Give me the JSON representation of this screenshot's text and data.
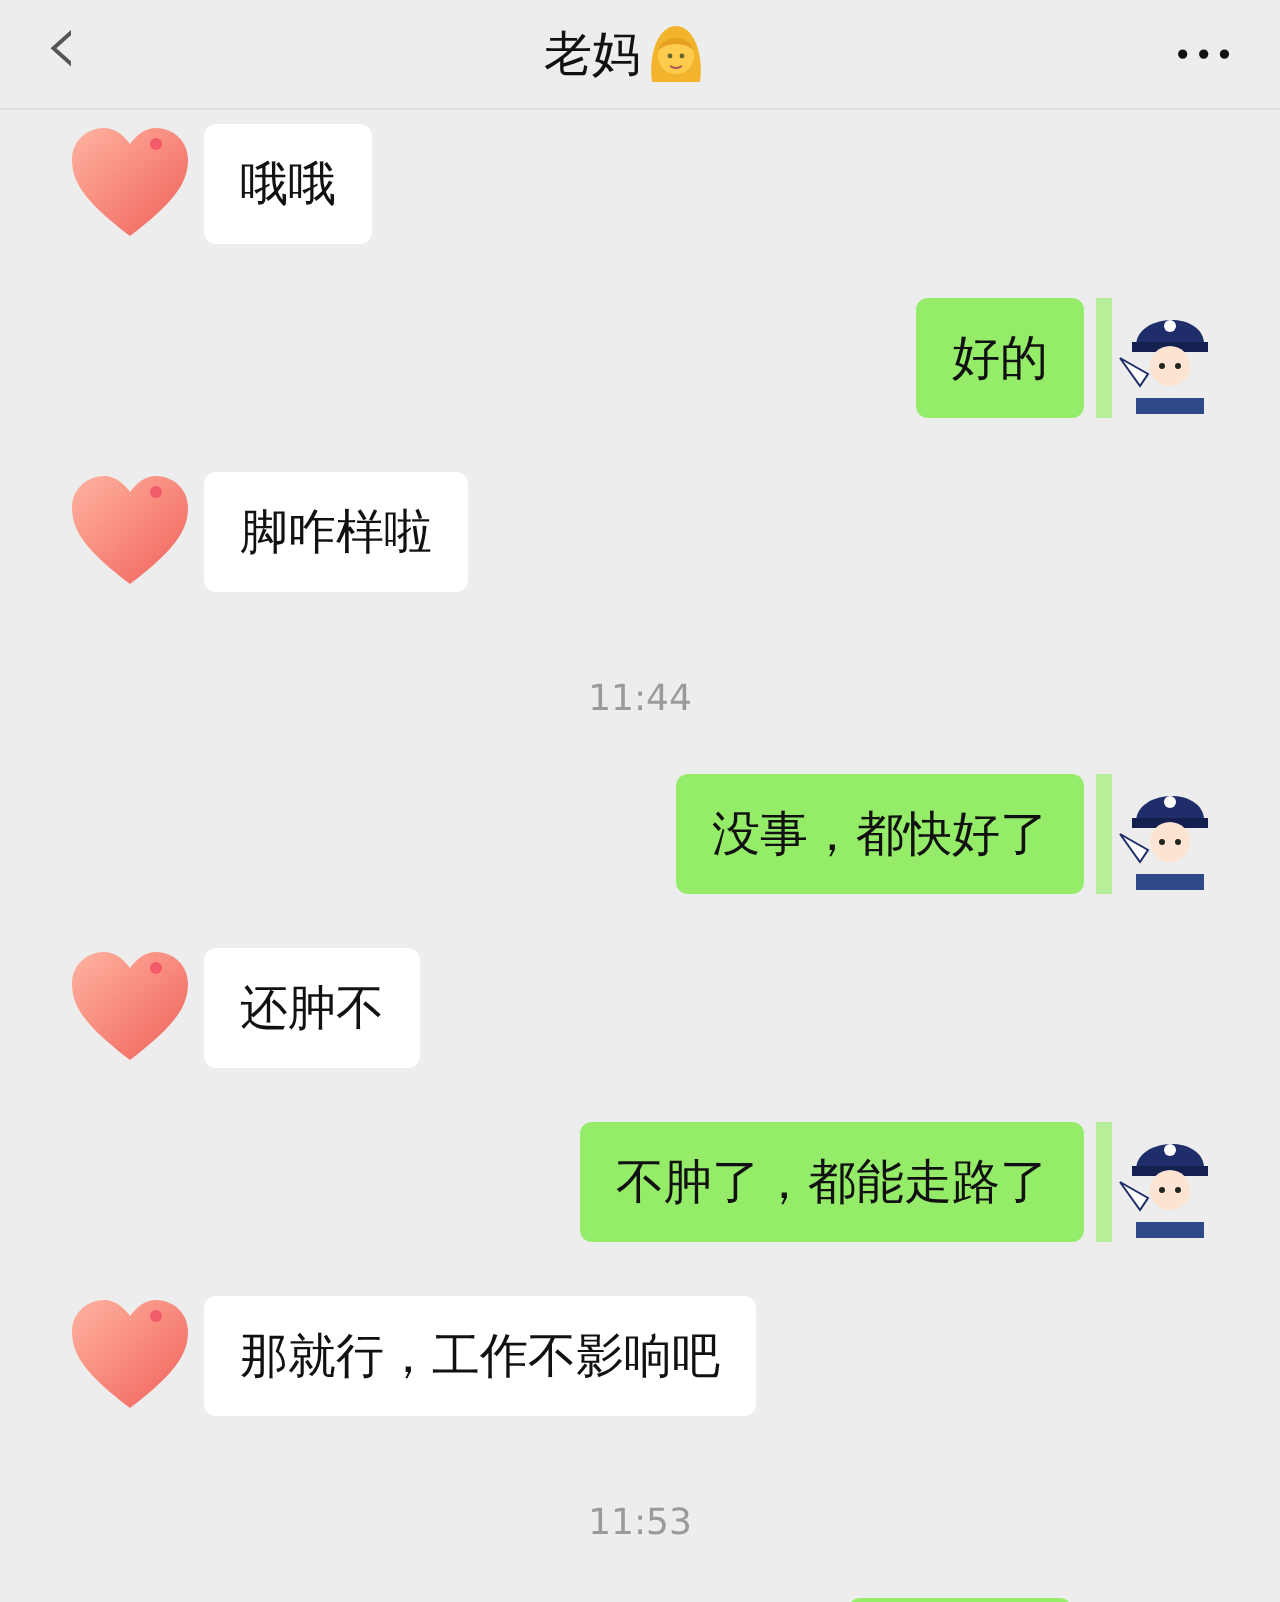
{
  "header": {
    "back": "‹",
    "title": "老妈",
    "more": "•••"
  },
  "messages": [
    {
      "kind": "in",
      "text": "哦哦"
    },
    {
      "kind": "out",
      "text": "好的"
    },
    {
      "kind": "in",
      "text": "脚咋样啦"
    },
    {
      "kind": "time",
      "text": "11:44"
    },
    {
      "kind": "out",
      "text": "没事，都快好了"
    },
    {
      "kind": "in",
      "text": "还肿不"
    },
    {
      "kind": "out",
      "text": "不肿了，都能走路了"
    },
    {
      "kind": "in",
      "text": "那就行，工作不影响吧"
    },
    {
      "kind": "time",
      "text": "11:53"
    },
    {
      "kind": "out_cut"
    }
  ]
}
